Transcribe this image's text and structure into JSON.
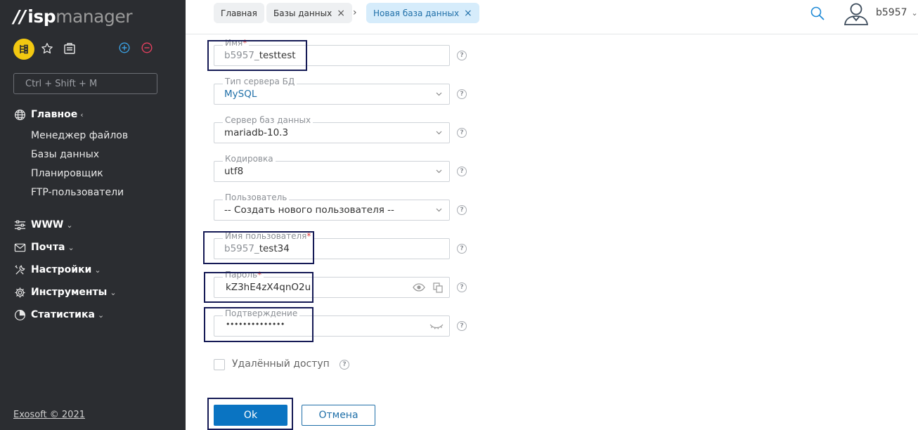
{
  "logo": {
    "bars": "//",
    "isp": "isp",
    "manager": "manager"
  },
  "sidebar": {
    "search_placeholder": "Ctrl + Shift + M",
    "groups": [
      {
        "label": "Главное",
        "chevron": "‹",
        "icon": "globe-icon"
      },
      {
        "label": "WWW",
        "chevron": "⌄",
        "icon": "sliders-icon"
      },
      {
        "label": "Почта",
        "chevron": "⌄",
        "icon": "mail-icon"
      },
      {
        "label": "Настройки",
        "chevron": "⌄",
        "icon": "wrench-icon"
      },
      {
        "label": "Инструменты",
        "chevron": "⌄",
        "icon": "gear-icon"
      },
      {
        "label": "Статистика",
        "chevron": "⌄",
        "icon": "pie-chart-icon"
      }
    ],
    "main_items": [
      "Менеджер файлов",
      "Базы данных",
      "Планировщик",
      "FTP-пользователи"
    ],
    "footer": "Exosoft © 2021"
  },
  "header": {
    "breadcrumbs": [
      {
        "label": "Главная"
      },
      {
        "label": "Базы данных",
        "closable": true
      },
      {
        "label": "Новая база данных",
        "closable": true,
        "active": true
      }
    ],
    "close_glyph": "×",
    "separator": "›",
    "username": "b5957",
    "user_chevron": "⌄"
  },
  "form": {
    "name": {
      "label": "Имя",
      "required_mark": "*",
      "prefix": "b5957_",
      "value": "testtest"
    },
    "db_type": {
      "label": "Тип сервера БД",
      "value": "MySQL"
    },
    "db_server": {
      "label": "Сервер баз данных",
      "value": "mariadb-10.3"
    },
    "encoding": {
      "label": "Кодировка",
      "value": "utf8"
    },
    "user": {
      "label": "Пользователь",
      "value": "-- Создать нового пользователя --"
    },
    "username": {
      "label": "Имя пользователя",
      "required_mark": "*",
      "prefix": "b5957_",
      "value": "test34"
    },
    "password": {
      "label": "Пароль",
      "required_mark": "*",
      "value": "kZ3hE4zX4qnO2u"
    },
    "confirm": {
      "label": "Подтверждение",
      "value": "••••••••••••••"
    },
    "remote_access": {
      "label": "Удалённый доступ",
      "checked": false
    },
    "help_glyph": "?",
    "ok_label": "Ok",
    "cancel_label": "Отмена"
  },
  "colors": {
    "sidebar_bg": "#2b2d31",
    "accent": "#0a74c2",
    "highlight": "#151a55",
    "toolbar_yellow": "#f2c811"
  }
}
